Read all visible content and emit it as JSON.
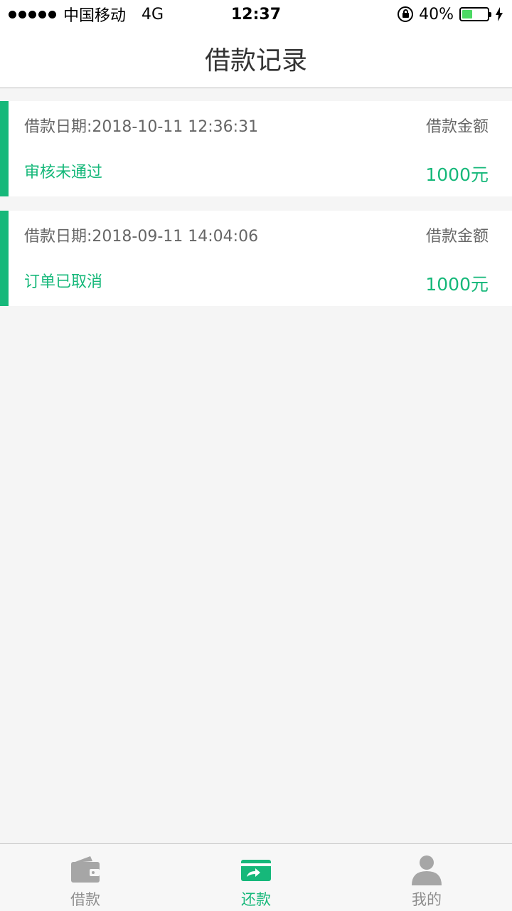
{
  "status_bar": {
    "carrier": "中国移动",
    "network": "4G",
    "time": "12:37",
    "battery_percent": "40%",
    "battery_level": 0.4
  },
  "header": {
    "title": "借款记录"
  },
  "records": [
    {
      "date": "借款日期:2018-10-11 12:36:31",
      "amount_label": "借款金额",
      "status": "审核未通过",
      "amount": "1000元"
    },
    {
      "date": "借款日期:2018-09-11 14:04:06",
      "amount_label": "借款金额",
      "status": "订单已取消",
      "amount": "1000元"
    }
  ],
  "tabs": [
    {
      "label": "借款",
      "icon": "wallet-icon",
      "active": false
    },
    {
      "label": "还款",
      "icon": "repay-card-icon",
      "active": true
    },
    {
      "label": "我的",
      "icon": "person-icon",
      "active": false
    }
  ],
  "colors": {
    "accent": "#16b87a",
    "inactive": "#9e9e9e",
    "battery": "#4cd964"
  }
}
